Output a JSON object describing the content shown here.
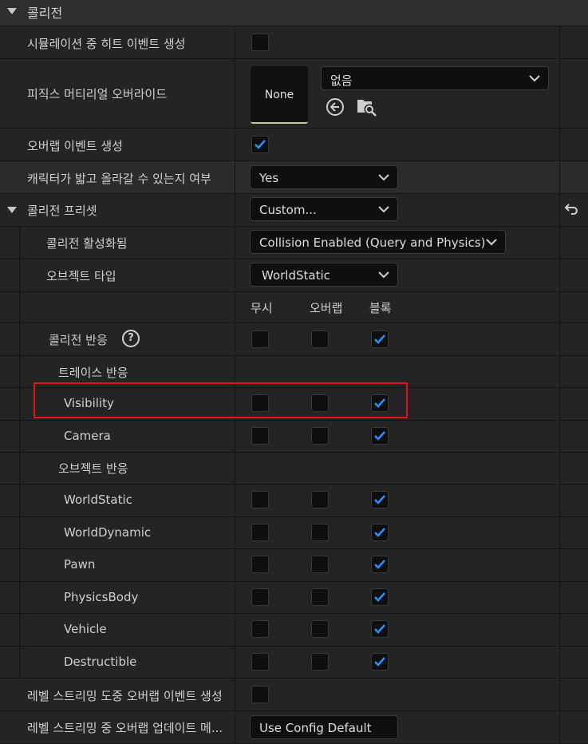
{
  "section": {
    "title": "콜리전"
  },
  "rows": {
    "sim_hit": {
      "label": "시뮬레이션 중 히트 이벤트 생성",
      "checked": false
    },
    "phys_mat": {
      "label": "피직스 머티리얼 오버라이드",
      "thumb": "None",
      "combo": "없음"
    },
    "overlap": {
      "label": "오버랩 이벤트 생성",
      "checked": true
    },
    "can_step": {
      "label": "캐릭터가 밟고 올라갈 수 있는지 여부",
      "combo": "Yes"
    },
    "preset": {
      "label": "콜리전 프리셋",
      "combo": "Custom..."
    },
    "enabled": {
      "label": "콜리전 활성화됨",
      "combo": "Collision Enabled (Query and Physics)"
    },
    "obj_type": {
      "label": "오브젝트 타입",
      "combo": "WorldStatic"
    },
    "response_header": {
      "label": "콜리전 반응",
      "help": "?"
    },
    "trace_header": {
      "label": "트레이스 반응"
    },
    "object_header": {
      "label": "오브젝트 반응"
    },
    "level_stream": {
      "label": "레벨 스트리밍 도중 오버랩 이벤트 생성",
      "checked": false
    },
    "update_overlap": {
      "label": "레벨 스트리밍 중 오버랩 업데이트 메...",
      "combo": "Use Config Default"
    }
  },
  "columns": {
    "ignore": "무시",
    "overlap": "오버랩",
    "block": "블록"
  },
  "trace_responses": [
    {
      "name": "Visibility",
      "response": "block"
    },
    {
      "name": "Camera",
      "response": "block"
    }
  ],
  "object_responses": [
    {
      "name": "WorldStatic",
      "response": "block"
    },
    {
      "name": "WorldDynamic",
      "response": "block"
    },
    {
      "name": "Pawn",
      "response": "block"
    },
    {
      "name": "PhysicsBody",
      "response": "block"
    },
    {
      "name": "Vehicle",
      "response": "block"
    },
    {
      "name": "Destructible",
      "response": "block"
    }
  ],
  "colors": {
    "check": "#2a8fff",
    "highlight": "#e0161a"
  }
}
